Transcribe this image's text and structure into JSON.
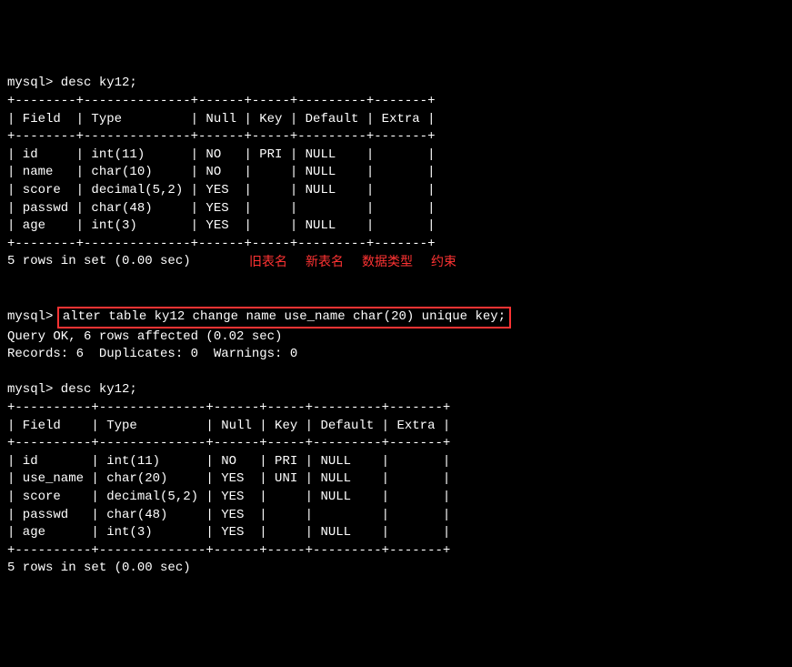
{
  "prompt1": "mysql> desc ky12;",
  "table1": {
    "border": "+--------+--------------+------+-----+---------+-------+",
    "header": "| Field  | Type         | Null | Key | Default | Extra |",
    "rows": [
      "| id     | int(11)      | NO   | PRI | NULL    |       |",
      "| name   | char(10)     | NO   |     | NULL    |       |",
      "| score  | decimal(5,2) | YES  |     | NULL    |       |",
      "| passwd | char(48)     | YES  |     |         |       |",
      "| age    | int(3)       | YES  |     | NULL    |       |"
    ]
  },
  "result1": "5 rows in set (0.00 sec)",
  "annotations": {
    "label1": "旧表名",
    "label2": "新表名",
    "label3": "数据类型",
    "label4": "约束"
  },
  "prompt2_prefix": "mysql> ",
  "prompt2_cmd": "alter table ky12 change name use_name char(20) unique key;",
  "query_ok": "Query OK, 6 rows affected (0.02 sec)",
  "records": "Records: 6  Duplicates: 0  Warnings: 0",
  "prompt3": "mysql> desc ky12;",
  "table2": {
    "border": "+----------+--------------+------+-----+---------+-------+",
    "header": "| Field    | Type         | Null | Key | Default | Extra |",
    "rows": [
      "| id       | int(11)      | NO   | PRI | NULL    |       |",
      "| use_name | char(20)     | YES  | UNI | NULL    |       |",
      "| score    | decimal(5,2) | YES  |     | NULL    |       |",
      "| passwd   | char(48)     | YES  |     |         |       |",
      "| age      | int(3)       | YES  |     | NULL    |       |"
    ]
  },
  "result2": "5 rows in set (0.00 sec)"
}
